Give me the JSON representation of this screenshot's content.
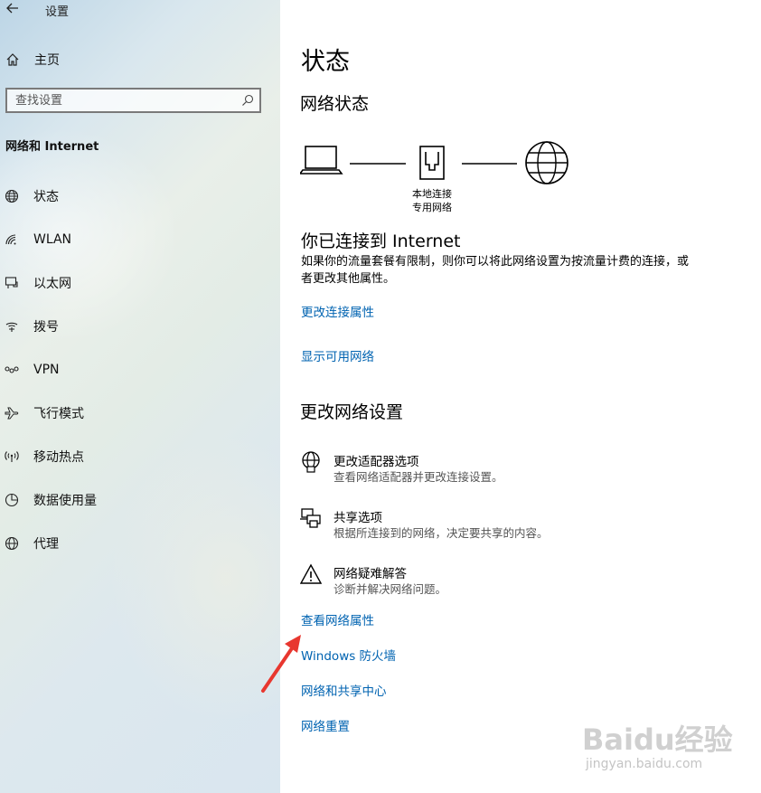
{
  "window": {
    "title": "设置"
  },
  "sidebar": {
    "home_label": "主页",
    "search_placeholder": "查找设置",
    "section_title": "网络和 Internet",
    "items": [
      {
        "label": "状态",
        "icon": "home-globe-icon"
      },
      {
        "label": "WLAN",
        "icon": "wifi-icon"
      },
      {
        "label": "以太网",
        "icon": "ethernet-icon"
      },
      {
        "label": "拨号",
        "icon": "dialup-icon"
      },
      {
        "label": "VPN",
        "icon": "vpn-icon"
      },
      {
        "label": "飞行模式",
        "icon": "airplane-icon"
      },
      {
        "label": "移动热点",
        "icon": "hotspot-icon"
      },
      {
        "label": "数据使用量",
        "icon": "data-usage-icon"
      },
      {
        "label": "代理",
        "icon": "proxy-globe-icon"
      }
    ]
  },
  "main": {
    "page_title": "状态",
    "network_status_heading": "网络状态",
    "diagram": {
      "adapter_label_line1": "本地连接",
      "adapter_label_line2": "专用网络"
    },
    "connected_title": "你已连接到 Internet",
    "connected_desc": "如果你的流量套餐有限制，则你可以将此网络设置为按流量计费的连接，或者更改其他属性。",
    "link_change_conn_props": "更改连接属性",
    "link_show_networks": "显示可用网络",
    "change_settings_heading": "更改网络设置",
    "options": [
      {
        "title": "更改适配器选项",
        "desc": "查看网络适配器并更改连接设置。",
        "icon": "adapter-globe-icon"
      },
      {
        "title": "共享选项",
        "desc": "根据所连接到的网络，决定要共享的内容。",
        "icon": "sharing-printer-icon"
      },
      {
        "title": "网络疑难解答",
        "desc": "诊断并解决网络问题。",
        "icon": "warning-icon"
      }
    ],
    "link_view_props": "查看网络属性",
    "link_firewall": "Windows 防火墙",
    "link_sharing_center": "网络和共享中心",
    "link_reset": "网络重置"
  },
  "watermark": {
    "brand": "Baidu经验",
    "url": "jingyan.baidu.com"
  },
  "colors": {
    "link": "#0063b1",
    "annotation_arrow": "#e8372f"
  }
}
